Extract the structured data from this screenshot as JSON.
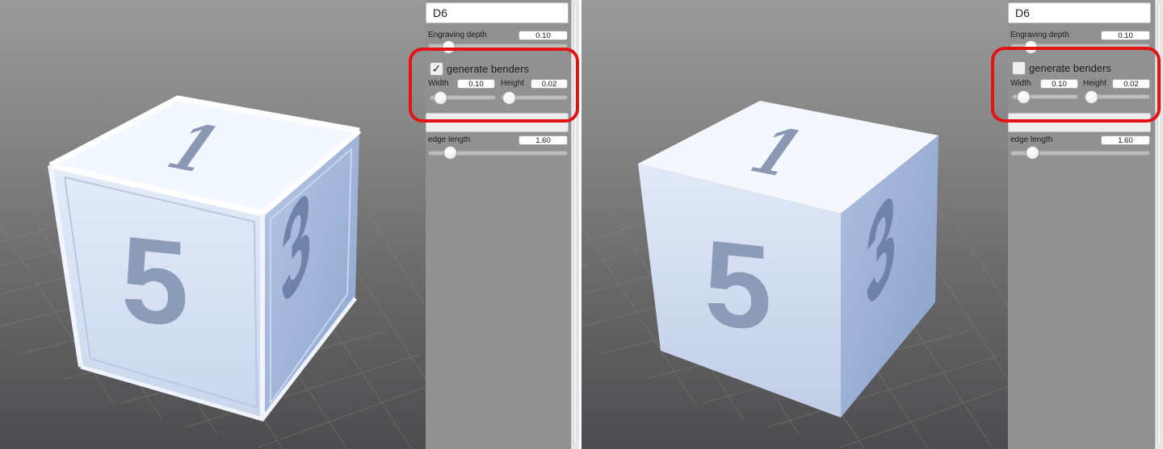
{
  "panels": [
    {
      "id": "left",
      "object_name": "D6",
      "engraving_depth_label": "Engraving depth",
      "engraving_depth_value": "0.10",
      "generate_benders_label": "generate benders",
      "generate_benders_checked": true,
      "check_glyph": "✓",
      "width_label": "Width",
      "width_value": "0.10",
      "height_label": "Height",
      "height_value": "0.02",
      "edge_length_label": "edge length",
      "edge_length_value": "1.60",
      "die_faces": {
        "top": "1",
        "front": "5",
        "side": "3"
      }
    },
    {
      "id": "right",
      "object_name": "D6",
      "engraving_depth_label": "Engraving depth",
      "engraving_depth_value": "0.10",
      "generate_benders_label": "generate benders",
      "generate_benders_checked": false,
      "check_glyph": "",
      "width_label": "Width",
      "width_value": "0.10",
      "height_label": "Height",
      "height_value": "0.02",
      "edge_length_label": "edge length",
      "edge_length_value": "1.60",
      "die_faces": {
        "top": "1",
        "front": "5",
        "side": "3"
      }
    }
  ],
  "colors": {
    "highlight": "#e31313",
    "die_face_front": "#dce6f6",
    "die_face_side": "#9fb4d8",
    "panel_bg": "#919191"
  },
  "icons": {
    "checkbox_checked": "checkmark-icon",
    "slider": "slider-knob"
  }
}
